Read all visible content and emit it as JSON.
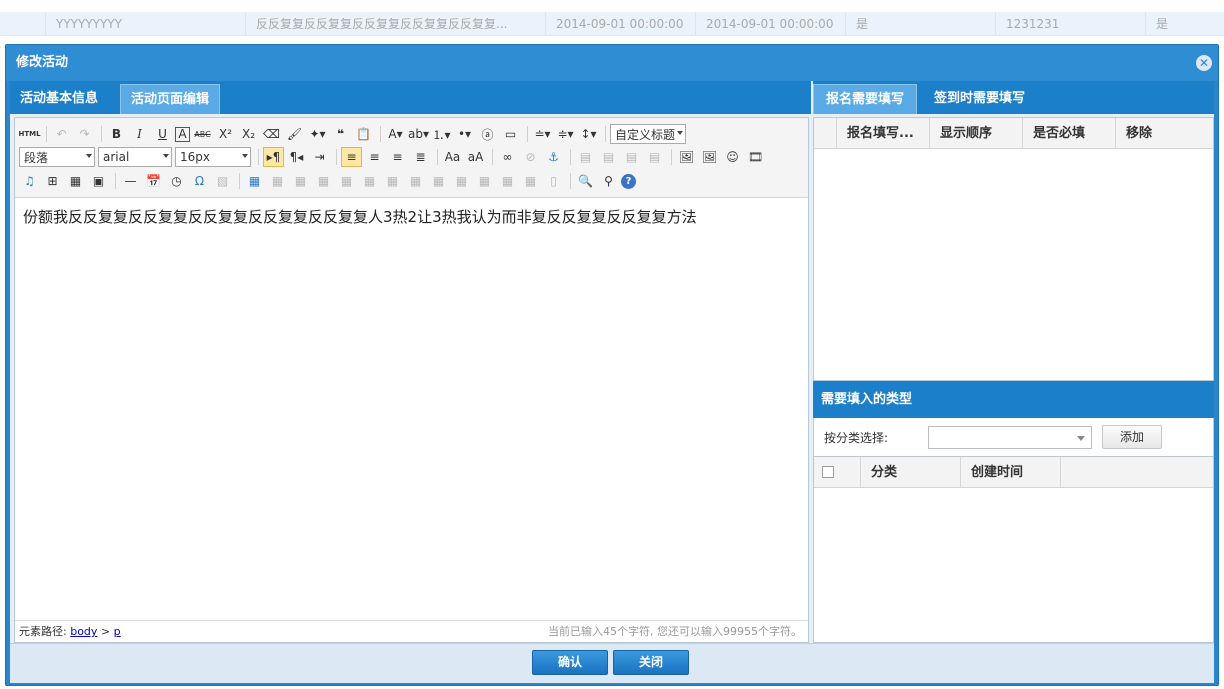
{
  "background_rows": [
    [
      "",
      "YYYYYYYYY",
      "反反复复反反复复反反复复反反复复反反复复...",
      "2014-09-01 00:00:00",
      "2014-09-01 00:00:00",
      "是",
      "1231231",
      "是"
    ]
  ],
  "dialog": {
    "title": "修改活动",
    "close_icon": "close-circle-icon",
    "left_tabs": [
      "活动基本信息",
      "活动页面编辑"
    ],
    "editor": {
      "toolbar": {
        "paragraph": "段落",
        "font": "arial",
        "size": "16px",
        "custom_heading": "自定义标题"
      },
      "content": "份额我反反复复反反复复反反复复反反复复反反复复人3热2让3热我认为而非复反反复复反反复复方法",
      "status": {
        "path_label": "元素路径:",
        "path_body": "body",
        "path_sep": ">",
        "path_p": "p",
        "char_count": "当前已输入45个字符, 您还可以输入99955个字符。"
      }
    },
    "right_tabs": [
      "报名需要填写",
      "签到时需要填写"
    ],
    "fields_grid": {
      "headers": [
        "报名填写...",
        "显示顺序",
        "是否必填",
        "移除"
      ]
    },
    "types_section": {
      "title": "需要填入的类型",
      "filter_label": "按分类选择:",
      "select_value": "",
      "add_button": "添加",
      "headers": [
        "分类",
        "创建时间"
      ]
    },
    "footer": {
      "confirm": "确认",
      "close": "关闭"
    }
  }
}
